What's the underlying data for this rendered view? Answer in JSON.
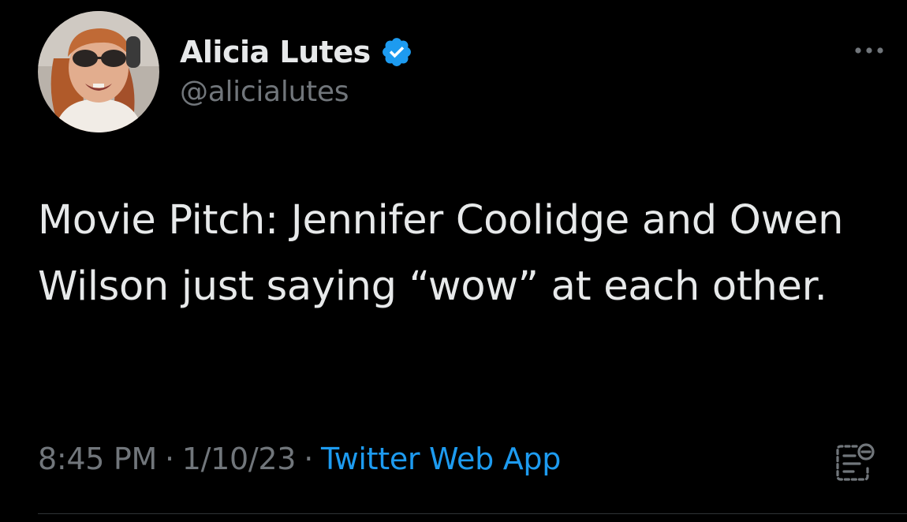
{
  "author": {
    "display_name": "Alicia Lutes",
    "handle": "@alicialutes",
    "avatar_icon": "profile-photo",
    "verified_icon": "verified-badge-icon"
  },
  "tweet": {
    "text": "Movie Pitch: Jennifer Coolidge and Owen Wilson just saying “wow” at each other."
  },
  "meta": {
    "time": "8:45 PM",
    "separator": "·",
    "date": "1/10/23",
    "source": "Twitter Web App"
  },
  "icons": {
    "more": "more-options-icon",
    "analytics": "analytics-icon"
  },
  "colors": {
    "background": "#000000",
    "primary_text": "#e7e9ea",
    "secondary_text": "#71767b",
    "accent": "#1d9bf0",
    "divider": "#2f3336"
  }
}
